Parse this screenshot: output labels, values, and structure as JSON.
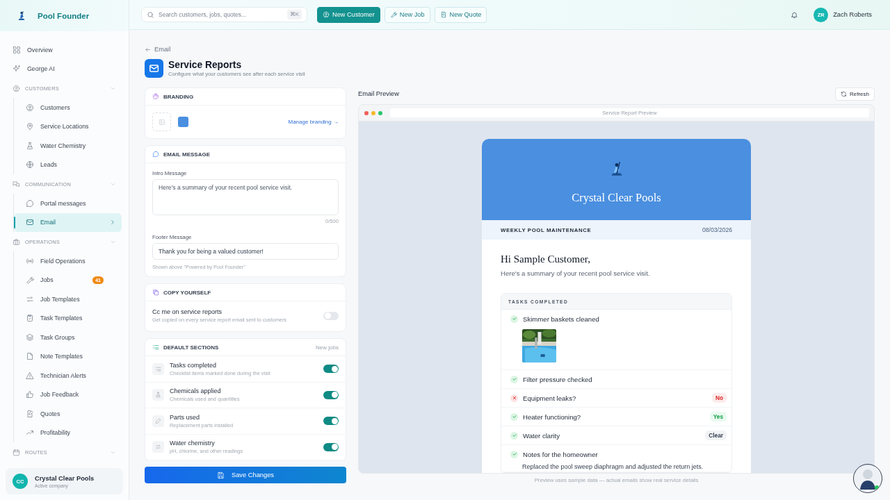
{
  "sidebar": {
    "brand": "Pool Founder",
    "items": [
      {
        "kind": "link",
        "label": "Overview",
        "selected": false
      },
      {
        "kind": "link",
        "label": "George AI",
        "selected": false
      },
      {
        "kind": "section",
        "label": "CUSTOMERS",
        "expanded": true,
        "children": [
          {
            "label": "Customers",
            "selected": false
          },
          {
            "label": "Service Locations",
            "selected": false
          },
          {
            "label": "Water Chemistry",
            "selected": false
          },
          {
            "label": "Leads",
            "selected": false
          }
        ]
      },
      {
        "kind": "section",
        "label": "COMMUNICATION",
        "expanded": true,
        "children": [
          {
            "label": "Portal messages",
            "selected": false
          },
          {
            "label": "Email",
            "selected": true
          }
        ]
      },
      {
        "kind": "section",
        "label": "OPERATIONS",
        "expanded": true,
        "children": [
          {
            "label": "Field Operations",
            "selected": false
          },
          {
            "label": "Jobs",
            "selected": false,
            "badge": "41"
          },
          {
            "label": "Job Templates",
            "selected": false
          },
          {
            "label": "Task Templates",
            "selected": false
          },
          {
            "label": "Task Groups",
            "selected": false
          },
          {
            "label": "Note Templates",
            "selected": false
          },
          {
            "label": "Technician Alerts",
            "selected": false
          },
          {
            "label": "Job Feedback",
            "selected": false
          },
          {
            "label": "Quotes",
            "selected": false
          },
          {
            "label": "Profitability",
            "selected": false
          }
        ]
      },
      {
        "kind": "section",
        "label": "ROUTES",
        "expanded": true
      }
    ],
    "company": {
      "initials": "CC",
      "name": "Crystal Clear Pools",
      "subtitle": "Active company"
    }
  },
  "topbar": {
    "search": {
      "placeholder": "Search customers, jobs, quotes...",
      "shortcut": "⌘K"
    },
    "actions": [
      {
        "label": "New Customer",
        "primary": true
      },
      {
        "label": "New Job",
        "primary": false
      },
      {
        "label": "New Quote",
        "primary": false
      }
    ],
    "user": {
      "initials": "ZR",
      "name": "Zach Roberts"
    }
  },
  "page": {
    "back": "Email",
    "title": "Service Reports",
    "subtitle": "Configure what your customers see after each service visit"
  },
  "branding": {
    "title": "BRANDING",
    "color": "#4a8fe0",
    "link": "Manage branding →"
  },
  "email_message": {
    "title": "EMAIL MESSAGE",
    "intro_label": "Intro Message",
    "intro_placeholder": "Here's a summary of your recent pool service visit.",
    "counter": "0/500",
    "footer_label": "Footer Message",
    "footer_value": "Thank you for being a valued customer!",
    "footer_hint": "Shown above \"Powered by Pool Founder\""
  },
  "copy_yourself": {
    "title": "COPY YOURSELF",
    "label": "Cc me on service reports",
    "hint": "Get copied on every service report email sent to customers",
    "on": false
  },
  "default_sections": {
    "title": "DEFAULT SECTIONS",
    "note": "New jobs",
    "items": [
      {
        "label": "Tasks completed",
        "hint": "Checklist items marked done during the visit",
        "on": true
      },
      {
        "label": "Chemicals applied",
        "hint": "Chemicals used and quantities",
        "on": true
      },
      {
        "label": "Parts used",
        "hint": "Replacement parts installed",
        "on": true
      },
      {
        "label": "Water chemistry",
        "hint": "pH, chlorine, and other readings",
        "on": true
      }
    ]
  },
  "save_button": "Save Changes",
  "preview": {
    "title": "Email Preview",
    "refresh": "Refresh",
    "window_title": "Service Report Preview",
    "email": {
      "company": "Crystal Clear Pools",
      "service": "WEEKLY POOL MAINTENANCE",
      "date": "08/03/2026",
      "greeting": "Hi Sample Customer,",
      "intro": "Here's a summary of your recent pool service visit.",
      "tasks_title": "TASKS COMPLETED",
      "tasks": [
        {
          "label": "Skimmer baskets cleaned",
          "passed": true
        },
        {
          "label": "Filter pressure checked",
          "passed": true
        },
        {
          "label": "Equipment leaks?",
          "passed": false,
          "result": {
            "text": "No",
            "kind": "negative"
          }
        },
        {
          "label": "Heater functioning?",
          "passed": true,
          "result": {
            "text": "Yes",
            "kind": "positive"
          }
        },
        {
          "label": "Water clarity",
          "passed": true,
          "result": {
            "text": "Clear",
            "kind": "neutral"
          }
        },
        {
          "label": "Notes for the homeowner",
          "passed": true,
          "note": "Replaced the pool sweep diaphragm and adjusted the return jets."
        }
      ]
    },
    "footnote": "Preview uses sample data — actual emails show real service details"
  }
}
